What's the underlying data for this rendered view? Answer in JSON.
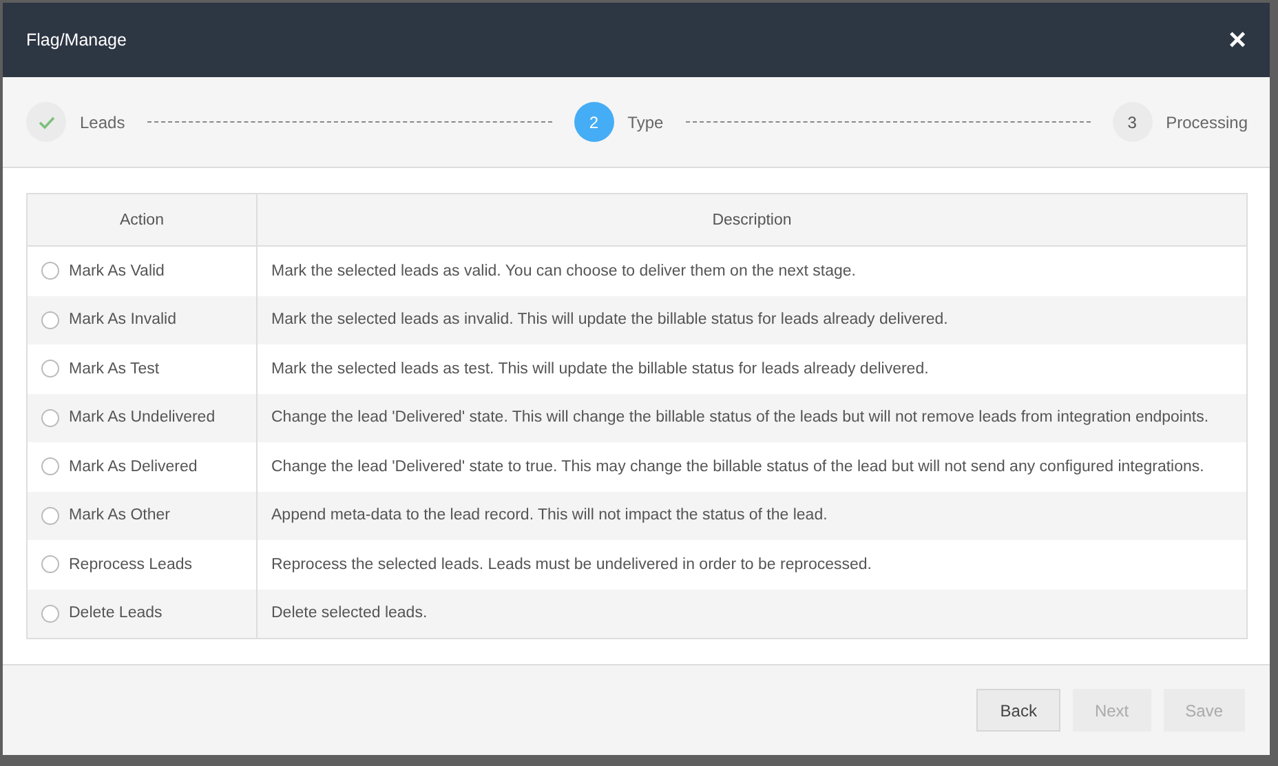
{
  "dialog": {
    "title": "Flag/Manage",
    "close": "×"
  },
  "steps": [
    {
      "label": "Leads",
      "completed": true,
      "selected": false
    },
    {
      "marker": "2",
      "label": "Type",
      "completed": false,
      "selected": true
    },
    {
      "marker": "3",
      "label": "Processing",
      "completed": false,
      "selected": false
    }
  ],
  "table": {
    "columns": [
      "Action",
      "Description"
    ],
    "rows": [
      {
        "action": "Mark As Valid",
        "selected": false,
        "description": "Mark the selected leads as valid. You can choose to deliver them on the next stage."
      },
      {
        "action": "Mark As Invalid",
        "selected": false,
        "description": "Mark the selected leads as invalid. This will update the billable status for leads already delivered."
      },
      {
        "action": "Mark As Test",
        "selected": false,
        "description": "Mark the selected leads as test. This will update the billable status for leads already delivered."
      },
      {
        "action": "Mark As Undelivered",
        "selected": false,
        "description": "Change the lead 'Delivered' state. This will change the billable status of the leads but will not remove leads from integration endpoints."
      },
      {
        "action": "Mark As Delivered",
        "selected": false,
        "description": "Change the lead 'Delivered' state to true. This may change the billable status of the lead but will not send any configured integrations."
      },
      {
        "action": "Mark As Other",
        "selected": false,
        "description": "Append meta-data to the lead record. This will not impact the status of the lead."
      },
      {
        "action": "Reprocess Leads",
        "selected": false,
        "description": "Reprocess the selected leads. Leads must be undelivered in order to be reprocessed."
      },
      {
        "action": "Delete Leads",
        "selected": false,
        "description": "Delete selected leads."
      }
    ]
  },
  "buttons": [
    {
      "label": "Back",
      "disabled": false
    },
    {
      "label": "Next",
      "disabled": true
    },
    {
      "label": "Save",
      "disabled": true
    }
  ]
}
